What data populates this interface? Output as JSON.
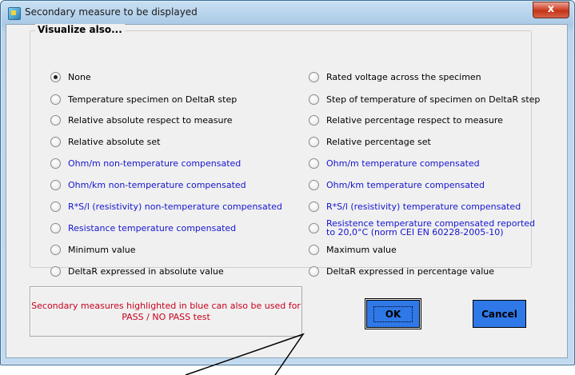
{
  "window": {
    "title": "Secondary measure to be displayed",
    "close_label": "x"
  },
  "group": {
    "legend": "Visualize also...",
    "left_options": [
      {
        "label": "None",
        "checked": true,
        "highlight": false
      },
      {
        "label": "Temperature specimen on DeltaR step",
        "checked": false,
        "highlight": false
      },
      {
        "label": "Relative absolute respect to measure",
        "checked": false,
        "highlight": false
      },
      {
        "label": "Relative absolute set",
        "checked": false,
        "highlight": false
      },
      {
        "label": "Ohm/m non-temperature compensated",
        "checked": false,
        "highlight": true
      },
      {
        "label": "Ohm/km non-temperature compensated",
        "checked": false,
        "highlight": true
      },
      {
        "label": "R*S/l (resistivity) non-temperature compensated",
        "checked": false,
        "highlight": true
      },
      {
        "label": "Resistance temperature compensated",
        "checked": false,
        "highlight": true
      },
      {
        "label": "Minimum value",
        "checked": false,
        "highlight": false
      },
      {
        "label": "DeltaR expressed in absolute value",
        "checked": false,
        "highlight": false
      }
    ],
    "right_options": [
      {
        "label": "Rated voltage across the specimen",
        "checked": false,
        "highlight": false
      },
      {
        "label": "Step of temperature of specimen on DeltaR step",
        "checked": false,
        "highlight": false
      },
      {
        "label": "Relative percentage respect to measure",
        "checked": false,
        "highlight": false
      },
      {
        "label": "Relative percentage set",
        "checked": false,
        "highlight": false
      },
      {
        "label": "Ohm/m temperature compensated",
        "checked": false,
        "highlight": true
      },
      {
        "label": "Ohm/km temperature compensated",
        "checked": false,
        "highlight": true
      },
      {
        "label": "R*S/l (resistivity) temperature compensated",
        "checked": false,
        "highlight": true
      },
      {
        "label": "Resistence temperature compensated reported to 20,0°C (norm CEI EN 60228-2005-10)",
        "checked": false,
        "highlight": true
      },
      {
        "label": "Maximum value",
        "checked": false,
        "highlight": false
      },
      {
        "label": "DeltaR expressed in percentage value",
        "checked": false,
        "highlight": false
      }
    ]
  },
  "notice": {
    "text": "Secondary measures highlighted in blue can also be used for PASS / NO PASS test"
  },
  "buttons": {
    "ok_label": "OK",
    "cancel_label": "Cancel"
  },
  "colors": {
    "highlight_text": "#1515d0",
    "notice_text": "#c8001e",
    "button_face": "#2f78e8"
  }
}
